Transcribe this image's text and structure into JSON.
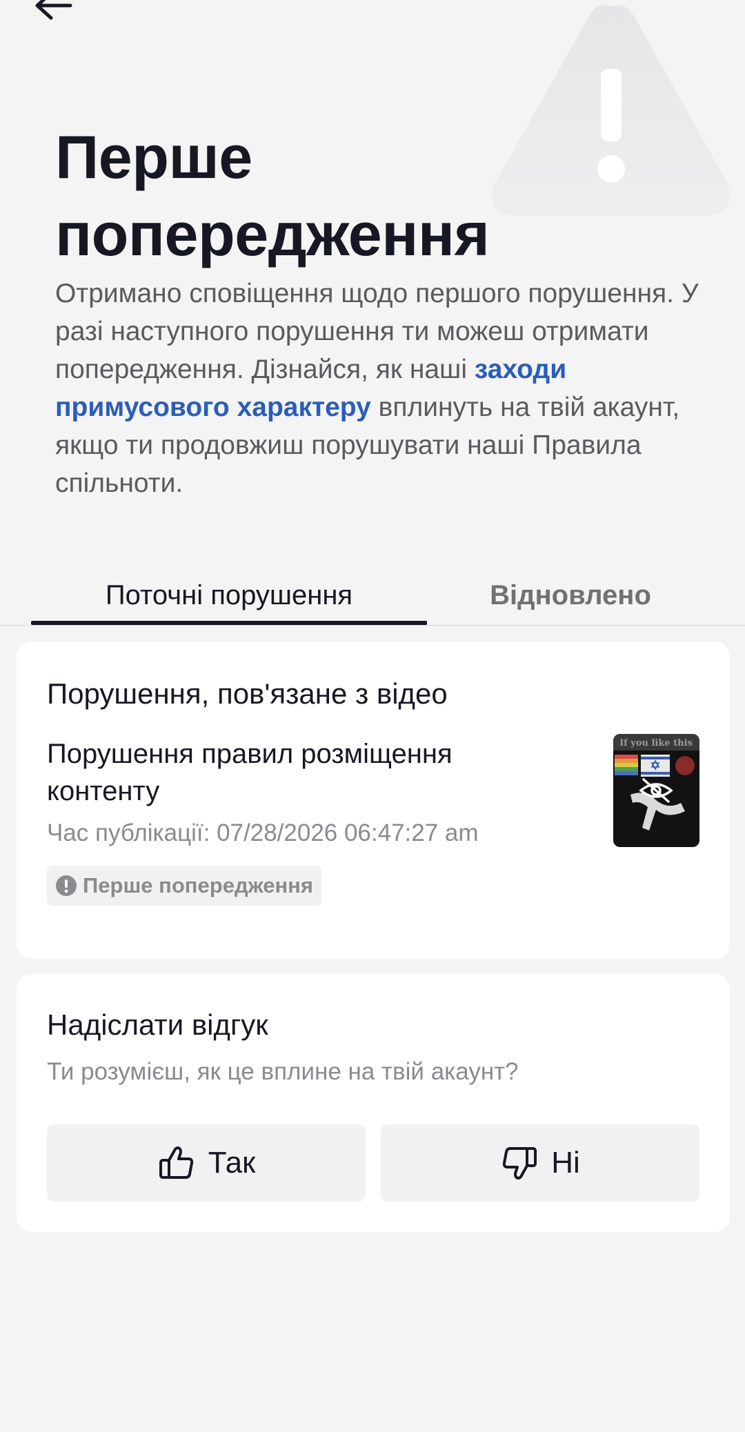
{
  "header": {
    "title": "Перше попередження",
    "description_before_link": "Отримано сповіщення щодо першого порушення. У разі наступного порушення ти можеш отримати попередження. Дізнайся, як наші ",
    "description_link": "заходи примусового характеру",
    "description_after_link": " вплинуть на твій акаунт, якщо ти продовжиш порушувати наші Правила спільноти."
  },
  "tabs": [
    {
      "label": "Поточні порушення",
      "active": true
    },
    {
      "label": "Відновлено",
      "active": false
    }
  ],
  "violation": {
    "heading": "Порушення, пов'язане з відео",
    "reason": "Порушення правил розміщення контенту",
    "time": "Час публікації: 07/28/2026 06:47:27 am",
    "badge": "Перше попередження",
    "thumbnail_caption": "If you like this"
  },
  "feedback": {
    "heading": "Надіслати відгук",
    "question": "Ти розумієш, як це вплине на твій акаунт?",
    "yes_label": "Так",
    "no_label": "Ні"
  },
  "colors": {
    "link": "#2b5db9",
    "text": "#161823",
    "muted": "#8a8a8f",
    "background": "#f4f4f4"
  },
  "icons": [
    "back-arrow-icon",
    "warning-triangle-icon",
    "exclamation-circle-icon",
    "hidden-eye-icon",
    "thumbs-up-icon",
    "thumbs-down-icon"
  ]
}
